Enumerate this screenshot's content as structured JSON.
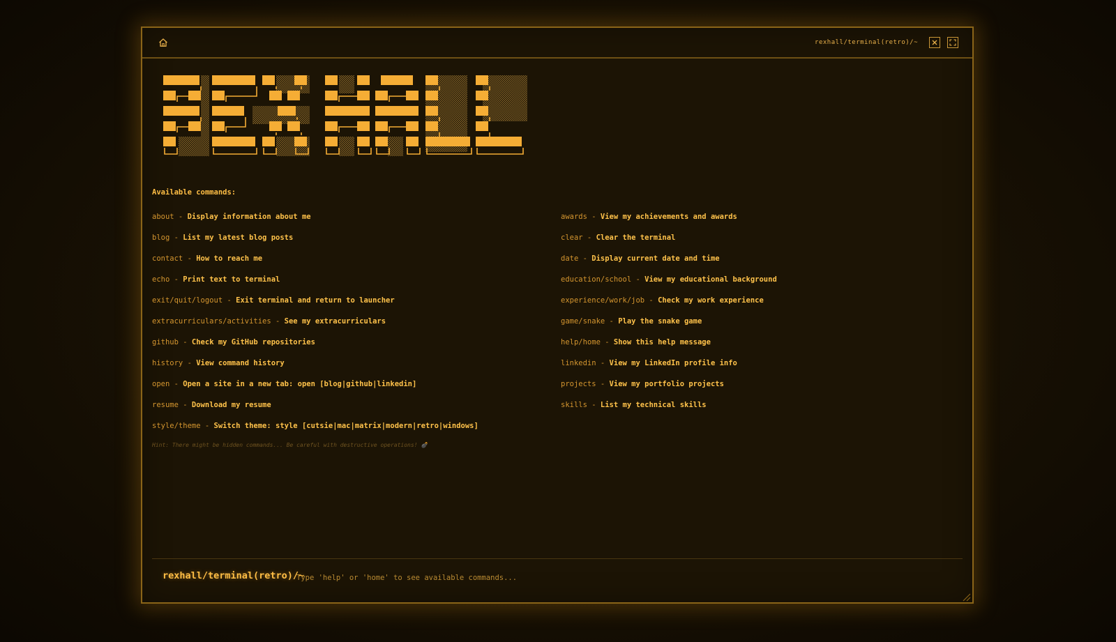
{
  "window": {
    "title": "rexhall/terminal(retro)/~"
  },
  "titlebar": {
    "icons": [
      "home-icon",
      "close-icon",
      "maximize-icon"
    ]
  },
  "banner": {
    "description_icon": "ascii-art-banner"
  },
  "help": {
    "heading": "Available commands:",
    "left": [
      {
        "name": "about",
        "desc": "Display information about me"
      },
      {
        "name": "blog",
        "desc": "List my latest blog posts"
      },
      {
        "name": "contact",
        "desc": "How to reach me"
      },
      {
        "name": "echo",
        "desc": "Print text to terminal"
      },
      {
        "name": "exit/quit/logout",
        "desc": "Exit terminal and return to launcher"
      },
      {
        "name": "extracurriculars/activities",
        "desc": "See my extracurriculars"
      },
      {
        "name": "github",
        "desc": "Check my GitHub repositories"
      },
      {
        "name": "history",
        "desc": "View command history"
      },
      {
        "name": "open",
        "desc": "Open a site in a new tab: open [blog|github|linkedin]"
      },
      {
        "name": "resume",
        "desc": "Download my resume"
      },
      {
        "name": "style/theme",
        "desc": "Switch theme: style [cutsie|mac|matrix|modern|retro|windows]"
      }
    ],
    "right": [
      {
        "name": "awards",
        "desc": "View my achievements and awards"
      },
      {
        "name": "clear",
        "desc": "Clear the terminal"
      },
      {
        "name": "date",
        "desc": "Display current date and time"
      },
      {
        "name": "education/school",
        "desc": "View my educational background"
      },
      {
        "name": "experience/work/job",
        "desc": "Check my work experience"
      },
      {
        "name": "game/snake",
        "desc": "Play the snake game"
      },
      {
        "name": "help/home",
        "desc": "Show this help message"
      },
      {
        "name": "linkedin",
        "desc": "View my LinkedIn profile info"
      },
      {
        "name": "projects",
        "desc": "View my portfolio projects"
      },
      {
        "name": "skills",
        "desc": "List my technical skills"
      }
    ],
    "separator": " - ",
    "hint": "Hint: There might be hidden commands... Be careful with destructive operations! 💣"
  },
  "prompt": {
    "label": "rexhall/terminal(retro)/~",
    "placeholder": "Type 'help' or 'home' to see available commands...",
    "value": ""
  },
  "colors": {
    "accent": "#ffbe45",
    "command_name": "#d5962f",
    "border": "#8a6418",
    "background": "#1c1405",
    "hint": "#6f5320"
  }
}
